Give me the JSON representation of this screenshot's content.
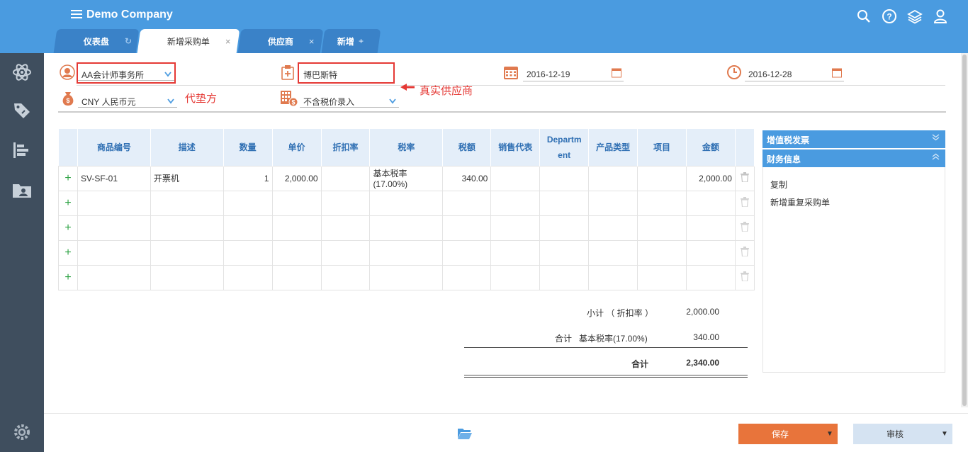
{
  "header": {
    "company": "Demo Company",
    "tabs": [
      {
        "label": "仪表盘"
      },
      {
        "label": "新增采购单"
      },
      {
        "label": "供应商"
      },
      {
        "label": "新增"
      }
    ],
    "new_tab_plus": "+",
    "close_glyph": "×",
    "refresh_glyph": "↻"
  },
  "form": {
    "payer": "AA会计师事务所",
    "supplier": "博巴斯特",
    "date1": "2016-12-19",
    "date2": "2016-12-28",
    "currency": "CNY 人民币元",
    "tax_mode": "不含税价录入"
  },
  "annotations": {
    "payer_note": "代垫方",
    "supplier_note": "真实供应商"
  },
  "table": {
    "headers": [
      "商品编号",
      "描述",
      "数量",
      "单价",
      "折扣率",
      "税率",
      "税额",
      "销售代表",
      "Department",
      "产品类型",
      "项目",
      "金额"
    ],
    "dept_header_line1": "Departm",
    "dept_header_line2": "ent",
    "rows": [
      {
        "code": "SV-SF-01",
        "desc": "开票机",
        "qty": "1",
        "price": "2,000.00",
        "discount": "",
        "tax_rate": "基本税率(17.00%)",
        "tax": "340.00",
        "rep": "",
        "dept": "",
        "ptype": "",
        "project": "",
        "amount": "2,000.00"
      }
    ],
    "empty_rows": 4,
    "plus": "+"
  },
  "totals": {
    "subtotal_label": "小计 （ 折扣率 ）",
    "subtotal_value": "2,000.00",
    "tax_label_a": "合计",
    "tax_label_b": "基本税率(17.00%)",
    "tax_value": "340.00",
    "grand_label": "合计",
    "grand_value": "2,340.00"
  },
  "right_panel": {
    "vat_header": "增值税发票",
    "finance_header": "财务信息",
    "links": [
      "复制",
      "新增重复采购单"
    ]
  },
  "footer": {
    "save": "保存",
    "approve": "审核"
  },
  "colors": {
    "topbar": "#4a9be0",
    "sidebar": "#3f4e5e",
    "save": "#e8743b",
    "annotation": "#e53935",
    "field_icon": "#e07a4f"
  }
}
